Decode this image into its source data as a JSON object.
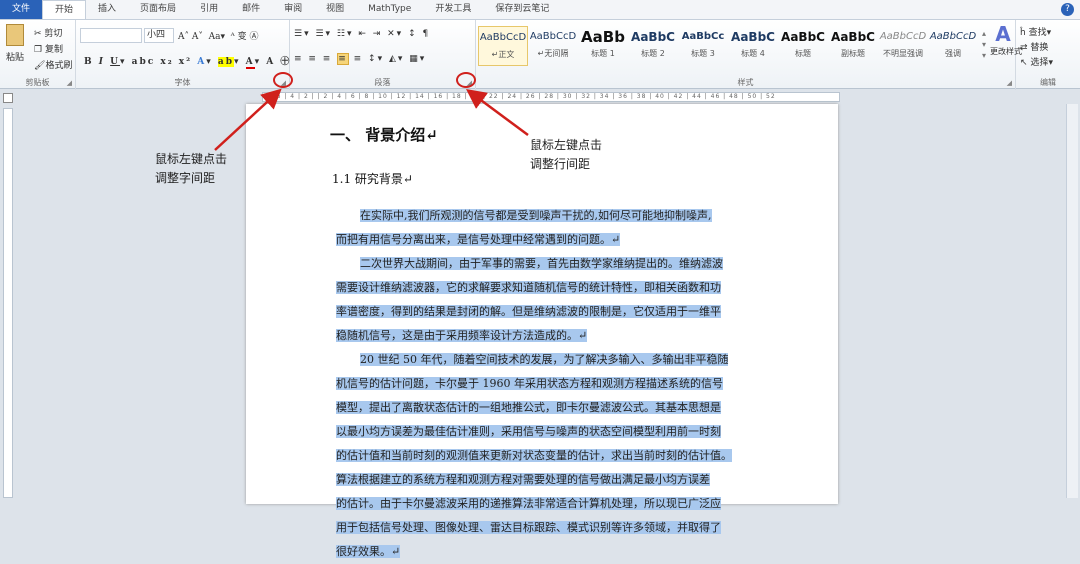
{
  "tabs": [
    "文件",
    "开始",
    "插入",
    "页面布局",
    "引用",
    "邮件",
    "审阅",
    "视图",
    "MathType",
    "开发工具",
    "保存到云笔记"
  ],
  "clipboard": {
    "paste": "粘贴",
    "cut": "剪切",
    "copy": "复制",
    "format_painter": "格式刷",
    "label": "剪贴板"
  },
  "font": {
    "name_value": "",
    "size_value": "小四",
    "label": "字体"
  },
  "paragraph": {
    "label": "段落"
  },
  "styles": {
    "items": [
      {
        "sample": "AaBbCcD",
        "label": "↵正文"
      },
      {
        "sample": "AaBbCcD",
        "label": "↵无间隔"
      },
      {
        "sample": "AaBb",
        "label": "标题 1"
      },
      {
        "sample": "AaBbC",
        "label": "标题 2"
      },
      {
        "sample": "AaBbCc",
        "label": "标题 3"
      },
      {
        "sample": "AaBbC",
        "label": "标题 4"
      },
      {
        "sample": "AaBbC",
        "label": "标题"
      },
      {
        "sample": "AaBbC",
        "label": "副标题"
      },
      {
        "sample": "AaBbCcD",
        "label": "不明显强调"
      },
      {
        "sample": "AaBbCcD",
        "label": "强调"
      }
    ],
    "change": "更改样式",
    "label": "样式"
  },
  "editing": {
    "find": "查找",
    "replace": "替换",
    "select": "选择",
    "label": "编辑"
  },
  "ruler": "8 | 6 | 4 | 2 |  | 2 | 4 | 6 | 8 | 10 | 12 | 14 | 16 | 18 | 20 | 22 | 24 | 26 | 28 | 30 | 32 | 34 | 36 | 38 | 40 | 42 | 44 | 46 | 48 | 50 | 52",
  "document": {
    "heading1": "一、  背景介绍↵",
    "heading2": "1.1  研究背景↵",
    "lines": [
      {
        "t": "在实际中,我们所观测的信号都是受到噪声干扰的,如何尽可能地抑制噪声,",
        "i": true
      },
      {
        "t": "而把有用信号分离出来，是信号处理中经常遇到的问题。↵",
        "i": false
      },
      {
        "t": "二次世界大战期间，由于军事的需要，首先由数学家维纳提出的。维纳滤波",
        "i": true
      },
      {
        "t": "需要设计维纳滤波器，它的求解要求知道随机信号的统计特性，即相关函数和功",
        "i": false
      },
      {
        "t": "率谱密度，得到的结果是封闭的解。但是维纳滤波的限制是，它仅适用于一维平",
        "i": false
      },
      {
        "t": "稳随机信号，这是由于采用频率设计方法造成的。↵",
        "i": false
      },
      {
        "t": "20 世纪 50 年代，随着空间技术的发展，为了解决多输入、多输出非平稳随",
        "i": true
      },
      {
        "t": "机信号的估计问题，卡尔曼于 1960 年采用状态方程和观测方程描述系统的信号",
        "i": false
      },
      {
        "t": "模型，提出了离散状态估计的一组地推公式，即卡尔曼滤波公式。其基本思想是",
        "i": false
      },
      {
        "t": "以最小均方误差为最佳估计准则，采用信号与噪声的状态空间模型利用前一时刻",
        "i": false
      },
      {
        "t": "的估计值和当前时刻的观测值来更新对状态变量的估计，求出当前时刻的估计值。",
        "i": false
      },
      {
        "t": "算法根据建立的系统方程和观测方程对需要处理的信号做出满足最小均方误差",
        "i": false
      },
      {
        "t": "的估计。由于卡尔曼滤波采用的递推算法非常适合计算机处理，所以现已广泛应",
        "i": false
      },
      {
        "t": "用于包括信号处理、图像处理、雷达目标跟踪、模式识别等许多领域，并取得了",
        "i": false
      },
      {
        "t": "很好效果。↵",
        "i": false
      }
    ]
  },
  "annotations": {
    "font_note_1": "鼠标左键点击",
    "font_note_2": "调整字间距",
    "para_note_1": "鼠标左键点击",
    "para_note_2": "调整行间距"
  },
  "colors": {
    "file_tab": "#2a62b8",
    "selection": "#a8c8ee",
    "annotation": "#d0201c"
  }
}
